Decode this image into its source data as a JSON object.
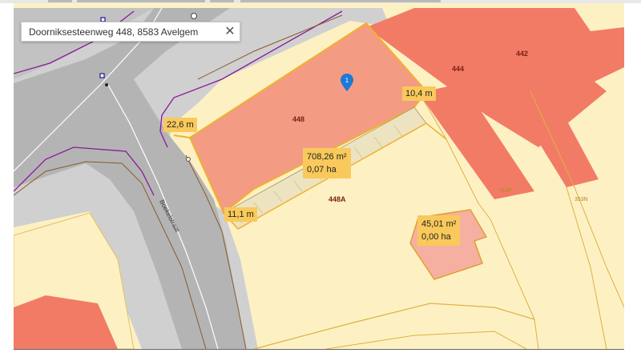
{
  "search": {
    "address": "Doorniksesteenweg 448, 8583 Avelgem",
    "close_glyph": "✕"
  },
  "street": {
    "name": "Boekelstraat"
  },
  "parcels": {
    "p448": "448",
    "p448a": "448A",
    "p444": "444",
    "p442": "442",
    "small1": "353P",
    "small2": "353N"
  },
  "measurements": {
    "side_left_top": "22,6 m",
    "side_right_top": "10,4 m",
    "side_bottom_left": "11,1 m"
  },
  "areas": {
    "main": {
      "m2": "708,26 m²",
      "ha": "0,07 ha"
    },
    "annex": {
      "m2": "45,01 m²",
      "ha": "0,00 ha"
    }
  },
  "marker": {
    "number": "1"
  },
  "colors": {
    "background": "#fdf1c4",
    "road": "#b4b4b4",
    "sidewalk": "#d0d0d0",
    "building": "#f27b66",
    "selected_parcel": "#f49b83",
    "annex": "#f6b0a2",
    "label_bg": "#f9c95c",
    "boundary": "#8a1a9a",
    "marker": "#1e78d8"
  }
}
